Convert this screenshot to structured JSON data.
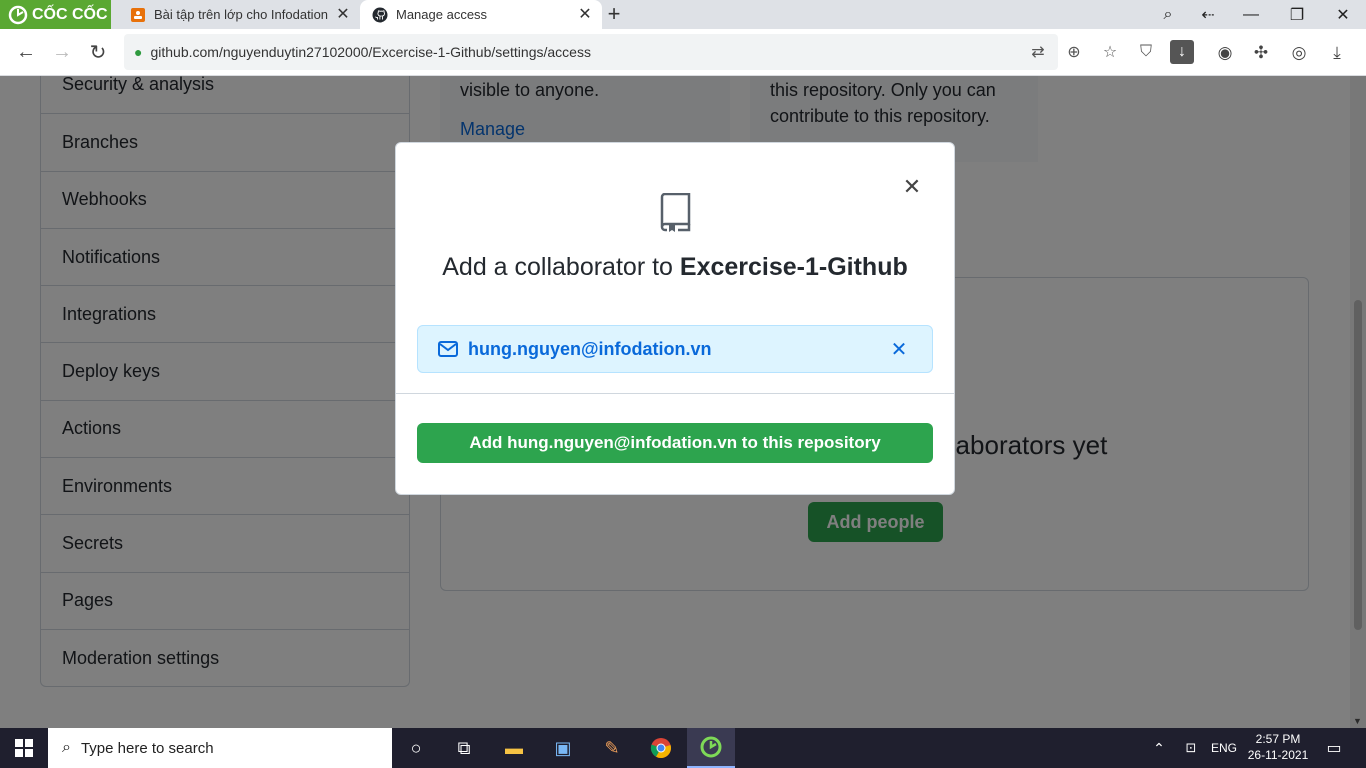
{
  "browser": {
    "brand_name": "CỐC CỐC",
    "tabs": [
      {
        "title": "Bài tập trên lớp cho Infodation",
        "active": false
      },
      {
        "title": "Manage access",
        "active": true
      }
    ],
    "url": "github.com/nguyenduytin27102000/Excercise-1-Github/settings/access"
  },
  "sidebar": {
    "items": [
      {
        "label": "Security & analysis"
      },
      {
        "label": "Branches"
      },
      {
        "label": "Webhooks"
      },
      {
        "label": "Notifications"
      },
      {
        "label": "Integrations"
      },
      {
        "label": "Deploy keys"
      },
      {
        "label": "Actions"
      },
      {
        "label": "Environments"
      },
      {
        "label": "Secrets"
      },
      {
        "label": "Pages"
      },
      {
        "label": "Moderation settings"
      }
    ]
  },
  "cards": {
    "public_text": "visible to anyone.",
    "manage_link": "Manage",
    "private_text_1": "this repository. Only you can",
    "private_text_2": "contribute to this repository."
  },
  "collaborators": {
    "empty_text": "You haven't invited any collaborators yet",
    "add_people_label": "Add people"
  },
  "modal": {
    "title_prefix": "Add a collaborator to ",
    "repo_name": "Excercise-1-Github",
    "selected_user": "hung.nguyen@infodation.vn",
    "confirm_label": "Add hung.nguyen@infodation.vn to this repository"
  },
  "taskbar": {
    "search_placeholder": "Type here to search",
    "language": "ENG",
    "time": "2:57 PM",
    "date": "26-11-2021"
  },
  "colors": {
    "primary_green": "#2da44e",
    "link_blue": "#0969da",
    "chip_bg": "#ddf4ff",
    "coccoc_green": "#5aa832"
  }
}
